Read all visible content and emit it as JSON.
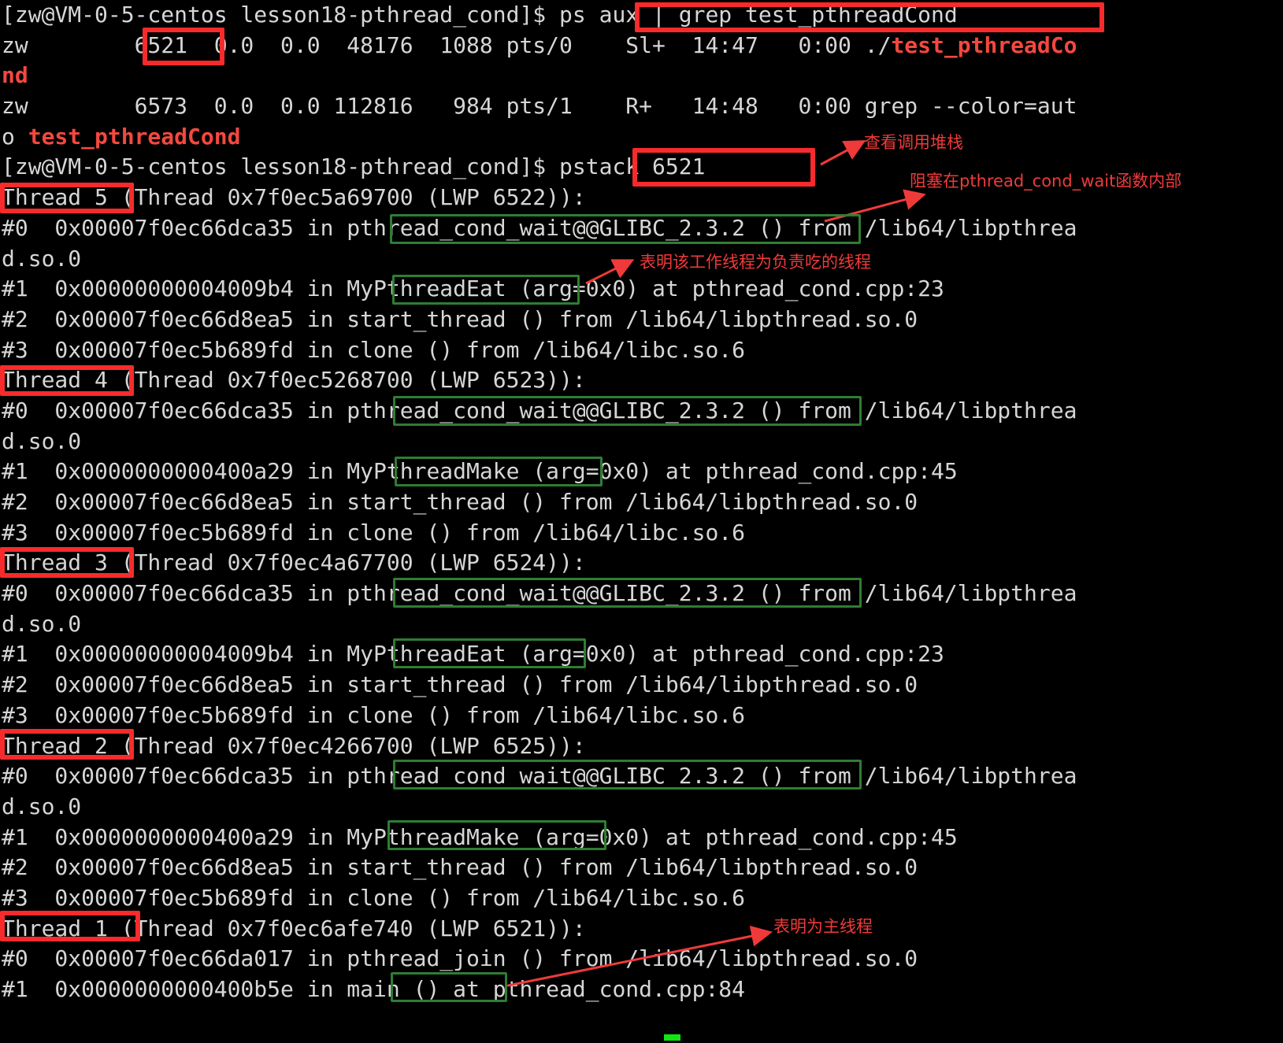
{
  "terminal": {
    "background": "#000000",
    "foreground": "#d6d6d6",
    "highlight_color": "#f4483f",
    "annotation_red": "#f72b2b",
    "annotation_green": "#2f7d33",
    "cursor_color": "#13e313",
    "prompt_user_host": "[zw@VM-0-5-centos lesson18-pthread_cond]$",
    "lines": [
      {
        "id": "l0",
        "segs": [
          {
            "t": "[zw@VM-0-5-centos lesson18-pthread_cond]$ ps aux | grep test_pthreadCond",
            "c": "dim"
          }
        ]
      },
      {
        "id": "l1",
        "segs": [
          {
            "t": "zw        6521  0.0  0.0  48176  1088 pts/0    Sl+  14:47   0:00 ./",
            "c": "dim"
          },
          {
            "t": "test_pthreadCo",
            "c": "hl"
          }
        ]
      },
      {
        "id": "l2",
        "segs": [
          {
            "t": "nd",
            "c": "hl"
          }
        ]
      },
      {
        "id": "l3",
        "segs": [
          {
            "t": "zw        6573  0.0  0.0 112816   984 pts/1    R+   14:48   0:00 grep --color=aut",
            "c": "dim"
          }
        ]
      },
      {
        "id": "l4",
        "segs": [
          {
            "t": "o ",
            "c": "dim"
          },
          {
            "t": "test_pthreadCond",
            "c": "hl"
          }
        ]
      },
      {
        "id": "l5",
        "segs": [
          {
            "t": "[zw@VM-0-5-centos lesson18-pthread_cond]$ pstack 6521",
            "c": "dim"
          }
        ]
      },
      {
        "id": "l6",
        "segs": [
          {
            "t": "Thread 5 (Thread 0x7f0ec5a69700 (LWP 6522)):",
            "c": "dim"
          }
        ]
      },
      {
        "id": "l7",
        "segs": [
          {
            "t": "#0  0x00007f0ec66dca35 in pthread_cond_wait@@GLIBC_2.3.2 () from /lib64/libpthrea",
            "c": "dim"
          }
        ]
      },
      {
        "id": "l8",
        "segs": [
          {
            "t": "d.so.0",
            "c": "dim"
          }
        ]
      },
      {
        "id": "l9",
        "segs": [
          {
            "t": "#1  0x00000000004009b4 in MyPthreadEat (arg=0x0) at pthread_cond.cpp:23",
            "c": "dim"
          }
        ]
      },
      {
        "id": "l10",
        "segs": [
          {
            "t": "#2  0x00007f0ec66d8ea5 in start_thread () from /lib64/libpthread.so.0",
            "c": "dim"
          }
        ]
      },
      {
        "id": "l11",
        "segs": [
          {
            "t": "#3  0x00007f0ec5b689fd in clone () from /lib64/libc.so.6",
            "c": "dim"
          }
        ]
      },
      {
        "id": "l12",
        "segs": [
          {
            "t": "Thread 4 (Thread 0x7f0ec5268700 (LWP 6523)):",
            "c": "dim"
          }
        ]
      },
      {
        "id": "l13",
        "segs": [
          {
            "t": "#0  0x00007f0ec66dca35 in pthread_cond_wait@@GLIBC_2.3.2 () from /lib64/libpthrea",
            "c": "dim"
          }
        ]
      },
      {
        "id": "l14",
        "segs": [
          {
            "t": "d.so.0",
            "c": "dim"
          }
        ]
      },
      {
        "id": "l15",
        "segs": [
          {
            "t": "#1  0x0000000000400a29 in MyPthreadMake (arg=0x0) at pthread_cond.cpp:45",
            "c": "dim"
          }
        ]
      },
      {
        "id": "l16",
        "segs": [
          {
            "t": "#2  0x00007f0ec66d8ea5 in start_thread () from /lib64/libpthread.so.0",
            "c": "dim"
          }
        ]
      },
      {
        "id": "l17",
        "segs": [
          {
            "t": "#3  0x00007f0ec5b689fd in clone () from /lib64/libc.so.6",
            "c": "dim"
          }
        ]
      },
      {
        "id": "l18",
        "segs": [
          {
            "t": "Thread 3 (Thread 0x7f0ec4a67700 (LWP 6524)):",
            "c": "dim"
          }
        ]
      },
      {
        "id": "l19",
        "segs": [
          {
            "t": "#0  0x00007f0ec66dca35 in pthread_cond_wait@@GLIBC_2.3.2 () from /lib64/libpthrea",
            "c": "dim"
          }
        ]
      },
      {
        "id": "l20",
        "segs": [
          {
            "t": "d.so.0",
            "c": "dim"
          }
        ]
      },
      {
        "id": "l21",
        "segs": [
          {
            "t": "#1  0x00000000004009b4 in MyPthreadEat (arg=0x0) at pthread_cond.cpp:23",
            "c": "dim"
          }
        ]
      },
      {
        "id": "l22",
        "segs": [
          {
            "t": "#2  0x00007f0ec66d8ea5 in start_thread () from /lib64/libpthread.so.0",
            "c": "dim"
          }
        ]
      },
      {
        "id": "l23",
        "segs": [
          {
            "t": "#3  0x00007f0ec5b689fd in clone () from /lib64/libc.so.6",
            "c": "dim"
          }
        ]
      },
      {
        "id": "l24",
        "segs": [
          {
            "t": "Thread 2 (Thread 0x7f0ec4266700 (LWP 6525)):",
            "c": "dim"
          }
        ]
      },
      {
        "id": "l25",
        "segs": [
          {
            "t": "#0  0x00007f0ec66dca35 in pthread_cond_wait@@GLIBC_2.3.2 () from /lib64/libpthrea",
            "c": "dim"
          }
        ]
      },
      {
        "id": "l26",
        "segs": [
          {
            "t": "d.so.0",
            "c": "dim"
          }
        ]
      },
      {
        "id": "l27",
        "segs": [
          {
            "t": "#1  0x0000000000400a29 in MyPthreadMake (arg=0x0) at pthread_cond.cpp:45",
            "c": "dim"
          }
        ]
      },
      {
        "id": "l28",
        "segs": [
          {
            "t": "#2  0x00007f0ec66d8ea5 in start_thread () from /lib64/libpthread.so.0",
            "c": "dim"
          }
        ]
      },
      {
        "id": "l29",
        "segs": [
          {
            "t": "#3  0x00007f0ec5b689fd in clone () from /lib64/libc.so.6",
            "c": "dim"
          }
        ]
      },
      {
        "id": "l30",
        "segs": [
          {
            "t": "Thread 1 (Thread 0x7f0ec6afe740 (LWP 6521)):",
            "c": "dim"
          }
        ]
      },
      {
        "id": "l31",
        "segs": [
          {
            "t": "#0  0x00007f0ec66da017 in pthread_join () from /lib64/libpthread.so.0",
            "c": "dim"
          }
        ]
      },
      {
        "id": "l32",
        "segs": [
          {
            "t": "#1  0x0000000000400b5e in main () at pthread_cond.cpp:84",
            "c": "dim"
          }
        ]
      }
    ]
  },
  "annotations": {
    "notes": [
      {
        "id": "n0",
        "text": "查看调用堆栈"
      },
      {
        "id": "n1",
        "text": "阻塞在pthread_cond_wait函数内部"
      },
      {
        "id": "n2",
        "text": "表明该工作线程为负责吃的线程"
      },
      {
        "id": "n3",
        "text": "表明为主线程"
      }
    ],
    "red_box_labels": [
      "ps aux | grep test_pthreadCond",
      "6521",
      "pstack 6521",
      "Thread 5",
      "Thread 4",
      "Thread 3",
      "Thread 2",
      "Thread 1"
    ],
    "green_box_labels": [
      "pthread_cond_wait@@GLIBC_2.3.2",
      "MyPthreadEat",
      "MyPthreadMake",
      "main ()"
    ]
  }
}
